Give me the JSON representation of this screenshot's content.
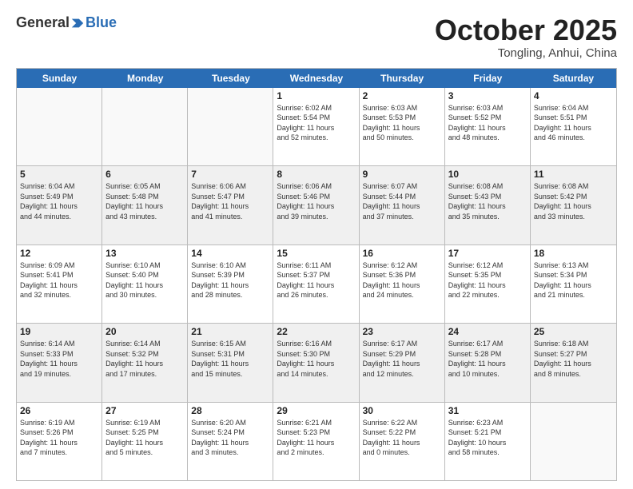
{
  "header": {
    "logo": {
      "general": "General",
      "blue": "Blue"
    },
    "month_title": "October 2025",
    "location": "Tongling, Anhui, China"
  },
  "weekdays": [
    "Sunday",
    "Monday",
    "Tuesday",
    "Wednesday",
    "Thursday",
    "Friday",
    "Saturday"
  ],
  "rows": [
    [
      {
        "day": "",
        "info": "",
        "empty": true
      },
      {
        "day": "",
        "info": "",
        "empty": true
      },
      {
        "day": "",
        "info": "",
        "empty": true
      },
      {
        "day": "1",
        "info": "Sunrise: 6:02 AM\nSunset: 5:54 PM\nDaylight: 11 hours\nand 52 minutes.",
        "empty": false
      },
      {
        "day": "2",
        "info": "Sunrise: 6:03 AM\nSunset: 5:53 PM\nDaylight: 11 hours\nand 50 minutes.",
        "empty": false
      },
      {
        "day": "3",
        "info": "Sunrise: 6:03 AM\nSunset: 5:52 PM\nDaylight: 11 hours\nand 48 minutes.",
        "empty": false
      },
      {
        "day": "4",
        "info": "Sunrise: 6:04 AM\nSunset: 5:51 PM\nDaylight: 11 hours\nand 46 minutes.",
        "empty": false
      }
    ],
    [
      {
        "day": "5",
        "info": "Sunrise: 6:04 AM\nSunset: 5:49 PM\nDaylight: 11 hours\nand 44 minutes.",
        "empty": false,
        "shaded": true
      },
      {
        "day": "6",
        "info": "Sunrise: 6:05 AM\nSunset: 5:48 PM\nDaylight: 11 hours\nand 43 minutes.",
        "empty": false,
        "shaded": true
      },
      {
        "day": "7",
        "info": "Sunrise: 6:06 AM\nSunset: 5:47 PM\nDaylight: 11 hours\nand 41 minutes.",
        "empty": false,
        "shaded": true
      },
      {
        "day": "8",
        "info": "Sunrise: 6:06 AM\nSunset: 5:46 PM\nDaylight: 11 hours\nand 39 minutes.",
        "empty": false,
        "shaded": true
      },
      {
        "day": "9",
        "info": "Sunrise: 6:07 AM\nSunset: 5:44 PM\nDaylight: 11 hours\nand 37 minutes.",
        "empty": false,
        "shaded": true
      },
      {
        "day": "10",
        "info": "Sunrise: 6:08 AM\nSunset: 5:43 PM\nDaylight: 11 hours\nand 35 minutes.",
        "empty": false,
        "shaded": true
      },
      {
        "day": "11",
        "info": "Sunrise: 6:08 AM\nSunset: 5:42 PM\nDaylight: 11 hours\nand 33 minutes.",
        "empty": false,
        "shaded": true
      }
    ],
    [
      {
        "day": "12",
        "info": "Sunrise: 6:09 AM\nSunset: 5:41 PM\nDaylight: 11 hours\nand 32 minutes.",
        "empty": false
      },
      {
        "day": "13",
        "info": "Sunrise: 6:10 AM\nSunset: 5:40 PM\nDaylight: 11 hours\nand 30 minutes.",
        "empty": false
      },
      {
        "day": "14",
        "info": "Sunrise: 6:10 AM\nSunset: 5:39 PM\nDaylight: 11 hours\nand 28 minutes.",
        "empty": false
      },
      {
        "day": "15",
        "info": "Sunrise: 6:11 AM\nSunset: 5:37 PM\nDaylight: 11 hours\nand 26 minutes.",
        "empty": false
      },
      {
        "day": "16",
        "info": "Sunrise: 6:12 AM\nSunset: 5:36 PM\nDaylight: 11 hours\nand 24 minutes.",
        "empty": false
      },
      {
        "day": "17",
        "info": "Sunrise: 6:12 AM\nSunset: 5:35 PM\nDaylight: 11 hours\nand 22 minutes.",
        "empty": false
      },
      {
        "day": "18",
        "info": "Sunrise: 6:13 AM\nSunset: 5:34 PM\nDaylight: 11 hours\nand 21 minutes.",
        "empty": false
      }
    ],
    [
      {
        "day": "19",
        "info": "Sunrise: 6:14 AM\nSunset: 5:33 PM\nDaylight: 11 hours\nand 19 minutes.",
        "empty": false,
        "shaded": true
      },
      {
        "day": "20",
        "info": "Sunrise: 6:14 AM\nSunset: 5:32 PM\nDaylight: 11 hours\nand 17 minutes.",
        "empty": false,
        "shaded": true
      },
      {
        "day": "21",
        "info": "Sunrise: 6:15 AM\nSunset: 5:31 PM\nDaylight: 11 hours\nand 15 minutes.",
        "empty": false,
        "shaded": true
      },
      {
        "day": "22",
        "info": "Sunrise: 6:16 AM\nSunset: 5:30 PM\nDaylight: 11 hours\nand 14 minutes.",
        "empty": false,
        "shaded": true
      },
      {
        "day": "23",
        "info": "Sunrise: 6:17 AM\nSunset: 5:29 PM\nDaylight: 11 hours\nand 12 minutes.",
        "empty": false,
        "shaded": true
      },
      {
        "day": "24",
        "info": "Sunrise: 6:17 AM\nSunset: 5:28 PM\nDaylight: 11 hours\nand 10 minutes.",
        "empty": false,
        "shaded": true
      },
      {
        "day": "25",
        "info": "Sunrise: 6:18 AM\nSunset: 5:27 PM\nDaylight: 11 hours\nand 8 minutes.",
        "empty": false,
        "shaded": true
      }
    ],
    [
      {
        "day": "26",
        "info": "Sunrise: 6:19 AM\nSunset: 5:26 PM\nDaylight: 11 hours\nand 7 minutes.",
        "empty": false
      },
      {
        "day": "27",
        "info": "Sunrise: 6:19 AM\nSunset: 5:25 PM\nDaylight: 11 hours\nand 5 minutes.",
        "empty": false
      },
      {
        "day": "28",
        "info": "Sunrise: 6:20 AM\nSunset: 5:24 PM\nDaylight: 11 hours\nand 3 minutes.",
        "empty": false
      },
      {
        "day": "29",
        "info": "Sunrise: 6:21 AM\nSunset: 5:23 PM\nDaylight: 11 hours\nand 2 minutes.",
        "empty": false
      },
      {
        "day": "30",
        "info": "Sunrise: 6:22 AM\nSunset: 5:22 PM\nDaylight: 11 hours\nand 0 minutes.",
        "empty": false
      },
      {
        "day": "31",
        "info": "Sunrise: 6:23 AM\nSunset: 5:21 PM\nDaylight: 10 hours\nand 58 minutes.",
        "empty": false
      },
      {
        "day": "",
        "info": "",
        "empty": true
      }
    ]
  ]
}
